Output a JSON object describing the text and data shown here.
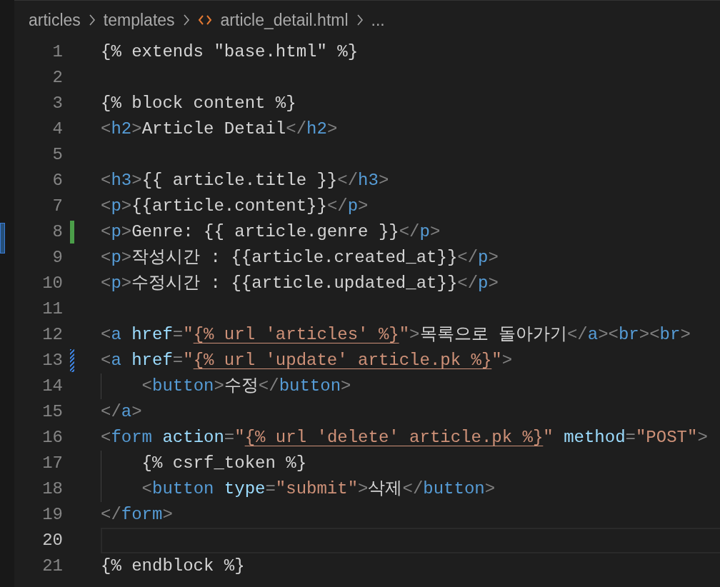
{
  "breadcrumb": [
    {
      "label": "articles",
      "kind": "folder"
    },
    {
      "label": "templates",
      "kind": "folder"
    },
    {
      "label": "article_detail.html",
      "kind": "html-file"
    },
    {
      "label": "...",
      "kind": "more"
    }
  ],
  "lines": [
    {
      "number": "1",
      "added": false,
      "modified": false,
      "current": false,
      "indented": false,
      "tokens": [
        {
          "kind": "text",
          "text": "{% extends \"base.html\" %}"
        }
      ]
    },
    {
      "number": "2",
      "added": false,
      "modified": false,
      "current": false,
      "indented": false
    },
    {
      "number": "3",
      "added": false,
      "modified": false,
      "current": false,
      "indented": false,
      "tokens": [
        {
          "kind": "text",
          "text": "{% block content %}"
        }
      ]
    },
    {
      "number": "4",
      "added": false,
      "modified": false,
      "current": false,
      "indented": false,
      "tokens": [
        {
          "kind": "punct",
          "text": "<"
        },
        {
          "kind": "tag",
          "text": "h2"
        },
        {
          "kind": "punct",
          "text": ">"
        },
        {
          "kind": "text",
          "text": "Article Detail"
        },
        {
          "kind": "punct",
          "text": "</"
        },
        {
          "kind": "tag",
          "text": "h2"
        },
        {
          "kind": "punct",
          "text": ">"
        }
      ]
    },
    {
      "number": "5",
      "added": false,
      "modified": false,
      "current": false,
      "indented": false
    },
    {
      "number": "6",
      "added": false,
      "modified": false,
      "current": false,
      "indented": false,
      "tokens": [
        {
          "kind": "punct",
          "text": "<"
        },
        {
          "kind": "tag",
          "text": "h3"
        },
        {
          "kind": "punct",
          "text": ">"
        },
        {
          "kind": "text",
          "text": "{{ article.title }}"
        },
        {
          "kind": "punct",
          "text": "</"
        },
        {
          "kind": "tag",
          "text": "h3"
        },
        {
          "kind": "punct",
          "text": ">"
        }
      ]
    },
    {
      "number": "7",
      "added": false,
      "modified": false,
      "current": false,
      "indented": false,
      "tokens": [
        {
          "kind": "punct",
          "text": "<"
        },
        {
          "kind": "tag",
          "text": "p"
        },
        {
          "kind": "punct",
          "text": ">"
        },
        {
          "kind": "text",
          "text": "{{article.content}}"
        },
        {
          "kind": "punct",
          "text": "</"
        },
        {
          "kind": "tag",
          "text": "p"
        },
        {
          "kind": "punct",
          "text": ">"
        }
      ]
    },
    {
      "number": "8",
      "added": true,
      "modified": false,
      "current": false,
      "indented": false,
      "tokens": [
        {
          "kind": "punct",
          "text": "<"
        },
        {
          "kind": "tag",
          "text": "p"
        },
        {
          "kind": "punct",
          "text": ">"
        },
        {
          "kind": "text",
          "text": "Genre: {{ article.genre }}"
        },
        {
          "kind": "punct",
          "text": "</"
        },
        {
          "kind": "tag",
          "text": "p"
        },
        {
          "kind": "punct",
          "text": ">"
        }
      ]
    },
    {
      "number": "9",
      "added": false,
      "modified": false,
      "current": false,
      "indented": false,
      "tokens": [
        {
          "kind": "punct",
          "text": "<"
        },
        {
          "kind": "tag",
          "text": "p"
        },
        {
          "kind": "punct",
          "text": ">"
        },
        {
          "kind": "text",
          "text": "작성시간 : {{article.created_at}}"
        },
        {
          "kind": "punct",
          "text": "</"
        },
        {
          "kind": "tag",
          "text": "p"
        },
        {
          "kind": "punct",
          "text": ">"
        }
      ]
    },
    {
      "number": "10",
      "added": false,
      "modified": false,
      "current": false,
      "indented": false,
      "tokens": [
        {
          "kind": "punct",
          "text": "<"
        },
        {
          "kind": "tag",
          "text": "p"
        },
        {
          "kind": "punct",
          "text": ">"
        },
        {
          "kind": "text",
          "text": "수정시간 : {{article.updated_at}}"
        },
        {
          "kind": "punct",
          "text": "</"
        },
        {
          "kind": "tag",
          "text": "p"
        },
        {
          "kind": "punct",
          "text": ">"
        }
      ]
    },
    {
      "number": "11",
      "added": false,
      "modified": false,
      "current": false,
      "indented": false
    },
    {
      "number": "12",
      "added": false,
      "modified": false,
      "current": false,
      "indented": false,
      "tokens": [
        {
          "kind": "punct",
          "text": "<"
        },
        {
          "kind": "tag",
          "text": "a"
        },
        {
          "kind": "attr",
          "text": " href"
        },
        {
          "kind": "punct",
          "text": "="
        },
        {
          "kind": "string",
          "text": "\""
        },
        {
          "kind": "link",
          "text": "{% url 'articles' %}"
        },
        {
          "kind": "string",
          "text": "\""
        },
        {
          "kind": "punct",
          "text": ">"
        },
        {
          "kind": "text",
          "text": "목록으로 돌아가기"
        },
        {
          "kind": "punct",
          "text": "</"
        },
        {
          "kind": "tag",
          "text": "a"
        },
        {
          "kind": "punct",
          "text": "><"
        },
        {
          "kind": "tag",
          "text": "br"
        },
        {
          "kind": "punct",
          "text": "><"
        },
        {
          "kind": "tag",
          "text": "br"
        },
        {
          "kind": "punct",
          "text": ">"
        }
      ]
    },
    {
      "number": "13",
      "added": false,
      "modified": true,
      "current": false,
      "indented": false,
      "tokens": [
        {
          "kind": "punct",
          "text": "<"
        },
        {
          "kind": "tag",
          "text": "a"
        },
        {
          "kind": "attr",
          "text": " href"
        },
        {
          "kind": "punct",
          "text": "="
        },
        {
          "kind": "string",
          "text": "\""
        },
        {
          "kind": "link",
          "text": "{% url 'update' article.pk %}"
        },
        {
          "kind": "string",
          "text": "\""
        },
        {
          "kind": "punct",
          "text": ">"
        }
      ]
    },
    {
      "number": "14",
      "added": false,
      "modified": false,
      "current": false,
      "indented": true,
      "tokens": [
        {
          "kind": "punct",
          "text": "<"
        },
        {
          "kind": "tag",
          "text": "button"
        },
        {
          "kind": "punct",
          "text": ">"
        },
        {
          "kind": "text",
          "text": "수정"
        },
        {
          "kind": "punct",
          "text": "</"
        },
        {
          "kind": "tag",
          "text": "button"
        },
        {
          "kind": "punct",
          "text": ">"
        }
      ]
    },
    {
      "number": "15",
      "added": false,
      "modified": false,
      "current": false,
      "indented": false,
      "tokens": [
        {
          "kind": "punct",
          "text": "</"
        },
        {
          "kind": "tag",
          "text": "a"
        },
        {
          "kind": "punct",
          "text": ">"
        }
      ]
    },
    {
      "number": "16",
      "added": false,
      "modified": false,
      "current": false,
      "indented": false,
      "tokens": [
        {
          "kind": "punct",
          "text": "<"
        },
        {
          "kind": "tag",
          "text": "form"
        },
        {
          "kind": "attr",
          "text": " action"
        },
        {
          "kind": "punct",
          "text": "="
        },
        {
          "kind": "string",
          "text": "\""
        },
        {
          "kind": "link",
          "text": "{% url 'delete' article.pk %}"
        },
        {
          "kind": "string",
          "text": "\""
        },
        {
          "kind": "attr",
          "text": " method"
        },
        {
          "kind": "punct",
          "text": "="
        },
        {
          "kind": "string",
          "text": "\"POST\""
        },
        {
          "kind": "punct",
          "text": ">"
        }
      ]
    },
    {
      "number": "17",
      "added": false,
      "modified": false,
      "current": false,
      "indented": true,
      "tokens": [
        {
          "kind": "text",
          "text": "{% csrf_token %}"
        }
      ]
    },
    {
      "number": "18",
      "added": false,
      "modified": false,
      "current": false,
      "indented": true,
      "tokens": [
        {
          "kind": "punct",
          "text": "<"
        },
        {
          "kind": "tag",
          "text": "button"
        },
        {
          "kind": "attr",
          "text": " type"
        },
        {
          "kind": "punct",
          "text": "="
        },
        {
          "kind": "string",
          "text": "\"submit\""
        },
        {
          "kind": "punct",
          "text": ">"
        },
        {
          "kind": "text",
          "text": "삭제"
        },
        {
          "kind": "punct",
          "text": "</"
        },
        {
          "kind": "tag",
          "text": "button"
        },
        {
          "kind": "punct",
          "text": ">"
        }
      ]
    },
    {
      "number": "19",
      "added": false,
      "modified": false,
      "current": false,
      "indented": false,
      "tokens": [
        {
          "kind": "punct",
          "text": "</"
        },
        {
          "kind": "tag",
          "text": "form"
        },
        {
          "kind": "punct",
          "text": ">"
        }
      ]
    },
    {
      "number": "20",
      "added": false,
      "modified": false,
      "current": true,
      "indented": false
    },
    {
      "number": "21",
      "added": false,
      "modified": false,
      "current": false,
      "indented": false,
      "tokens": [
        {
          "kind": "text",
          "text": "{% endblock %}"
        }
      ]
    }
  ]
}
